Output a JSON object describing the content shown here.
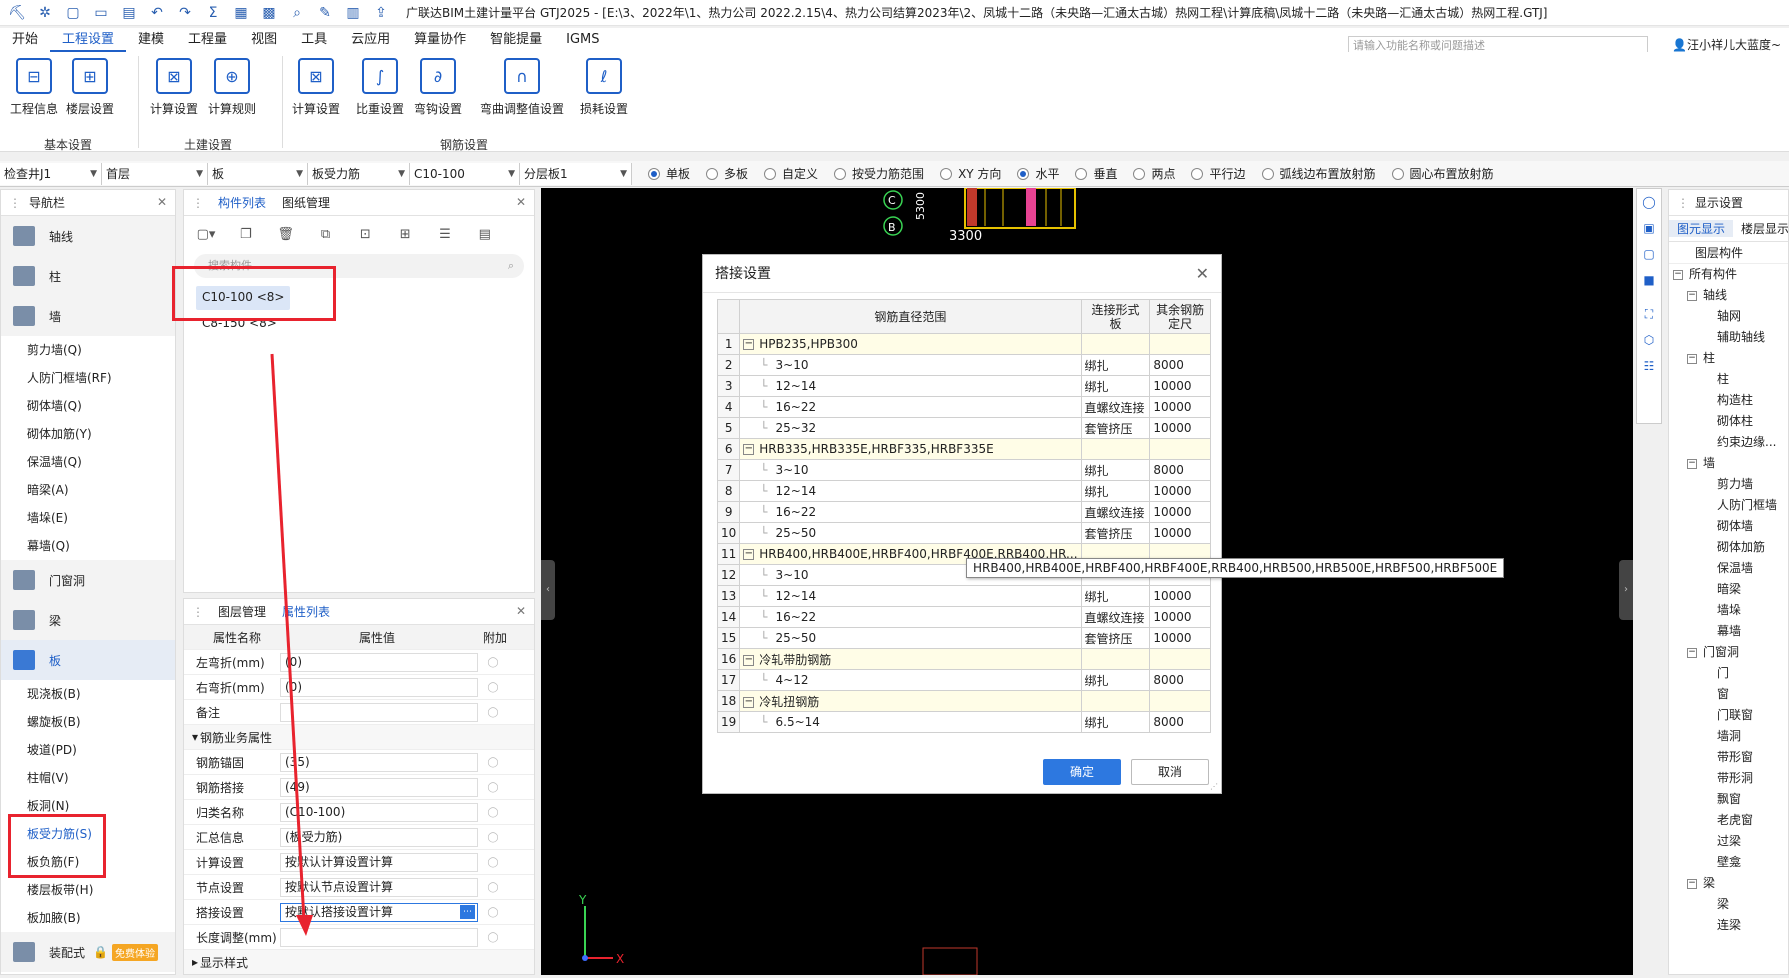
{
  "window": {
    "title": "广联达BIM土建计量平台 GTJ2025 - [E:\\3、2022年\\1、热力公司 2022.2.15\\4、热力公司结算2023年\\2、凤城十二路（未央路—汇通太古城）热网工程\\计算底稿\\凤城十二路（未央路—汇通太古城）热网工程.GTJ]"
  },
  "menu": {
    "tabs": [
      "开始",
      "工程设置",
      "建模",
      "工程量",
      "视图",
      "工具",
      "云应用",
      "算量协作",
      "智能提量",
      "IGMS"
    ],
    "search_placeholder": "请输入功能名称或问题描述",
    "user": "汪小祥儿大蓝度~"
  },
  "ribbon": {
    "groups": [
      {
        "label": "基本设置",
        "buttons": [
          "工程信息",
          "楼层设置"
        ]
      },
      {
        "label": "土建设置",
        "buttons": [
          "计算设置",
          "计算规则"
        ]
      },
      {
        "label": "钢筋设置",
        "buttons": [
          "计算设置",
          "比重设置",
          "弯钩设置",
          "弯曲调整值设置",
          "损耗设置"
        ]
      }
    ]
  },
  "options": {
    "combos": [
      "检查井J1",
      "首层",
      "板",
      "板受力筋",
      "C10-100",
      "分层板1"
    ],
    "radios": [
      {
        "label": "单板",
        "on": true
      },
      {
        "label": "多板",
        "on": false
      },
      {
        "label": "自定义",
        "on": false
      },
      {
        "label": "按受力筋范围",
        "on": false
      },
      {
        "label": "XY 方向",
        "on": false
      },
      {
        "label": "水平",
        "on": true
      },
      {
        "label": "垂直",
        "on": false
      },
      {
        "label": "两点",
        "on": false
      },
      {
        "label": "平行边",
        "on": false
      },
      {
        "label": "弧线边布置放射筋",
        "on": false
      },
      {
        "label": "圆心布置放射筋",
        "on": false
      }
    ]
  },
  "nav": {
    "title": "导航栏",
    "items": [
      {
        "label": "轴线",
        "kind": "big"
      },
      {
        "label": "柱",
        "kind": "big"
      },
      {
        "label": "墙",
        "kind": "big"
      },
      {
        "label": "剪力墙(Q)",
        "kind": "sub"
      },
      {
        "label": "人防门框墙(RF)",
        "kind": "sub"
      },
      {
        "label": "砌体墙(Q)",
        "kind": "sub"
      },
      {
        "label": "砌体加筋(Y)",
        "kind": "sub"
      },
      {
        "label": "保温墙(Q)",
        "kind": "sub"
      },
      {
        "label": "暗梁(A)",
        "kind": "sub"
      },
      {
        "label": "墙垛(E)",
        "kind": "sub"
      },
      {
        "label": "幕墙(Q)",
        "kind": "sub"
      },
      {
        "label": "门窗洞",
        "kind": "big"
      },
      {
        "label": "梁",
        "kind": "big"
      },
      {
        "label": "板",
        "kind": "bigsel"
      },
      {
        "label": "现浇板(B)",
        "kind": "sub"
      },
      {
        "label": "螺旋板(B)",
        "kind": "sub"
      },
      {
        "label": "坡道(PD)",
        "kind": "sub"
      },
      {
        "label": "柱帽(V)",
        "kind": "sub"
      },
      {
        "label": "板洞(N)",
        "kind": "sub"
      },
      {
        "label": "板受力筋(S)",
        "kind": "subsel"
      },
      {
        "label": "板负筋(F)",
        "kind": "sub"
      },
      {
        "label": "楼层板带(H)",
        "kind": "sub"
      },
      {
        "label": "板加腋(B)",
        "kind": "sub"
      }
    ],
    "bottom_label": "装配式",
    "trial_badge": "免费体验"
  },
  "components": {
    "tabs": [
      "构件列表",
      "图纸管理"
    ],
    "search_placeholder": "搜索构件...",
    "items": [
      "C10-100 <8>",
      "C8-150 <8>"
    ]
  },
  "properties": {
    "tabs": [
      "图层管理",
      "属性列表"
    ],
    "headers": [
      "属性名称",
      "属性值",
      "附加"
    ],
    "rows": [
      {
        "name": "左弯折(mm)",
        "value": "(0)"
      },
      {
        "name": "右弯折(mm)",
        "value": "(0)"
      },
      {
        "name": "备注",
        "value": ""
      }
    ],
    "group_title": "钢筋业务属性",
    "group_rows": [
      {
        "name": "钢筋锚固",
        "value": "(35)"
      },
      {
        "name": "钢筋搭接",
        "value": "(49)"
      },
      {
        "name": "归类名称",
        "value": "(C10-100)"
      },
      {
        "name": "汇总信息",
        "value": "(板受力筋)"
      },
      {
        "name": "计算设置",
        "value": "按默认计算设置计算"
      },
      {
        "name": "节点设置",
        "value": "按默认节点设置计算"
      },
      {
        "name": "搭接设置",
        "value": "按默认搭接设置计算"
      },
      {
        "name": "长度调整(mm)",
        "value": ""
      }
    ],
    "footer_group": "显示样式"
  },
  "dialog": {
    "title": "搭接设置",
    "headers": [
      "钢筋直径范围",
      "连接形式",
      "板",
      "其余钢筋定尺"
    ],
    "rows": [
      {
        "n": "1",
        "range": "HPB235,HPB300",
        "conn": "",
        "len": "",
        "group": true
      },
      {
        "n": "2",
        "range": "3~10",
        "conn": "绑扎",
        "len": "8000",
        "group": false
      },
      {
        "n": "3",
        "range": "12~14",
        "conn": "绑扎",
        "len": "10000",
        "group": false
      },
      {
        "n": "4",
        "range": "16~22",
        "conn": "直螺纹连接",
        "len": "10000",
        "group": false
      },
      {
        "n": "5",
        "range": "25~32",
        "conn": "套管挤压",
        "len": "10000",
        "group": false
      },
      {
        "n": "6",
        "range": "HRB335,HRB335E,HRBF335,HRBF335E",
        "conn": "",
        "len": "",
        "group": true
      },
      {
        "n": "7",
        "range": "3~10",
        "conn": "绑扎",
        "len": "8000",
        "group": false
      },
      {
        "n": "8",
        "range": "12~14",
        "conn": "绑扎",
        "len": "10000",
        "group": false
      },
      {
        "n": "9",
        "range": "16~22",
        "conn": "直螺纹连接",
        "len": "10000",
        "group": false
      },
      {
        "n": "10",
        "range": "25~50",
        "conn": "套管挤压",
        "len": "10000",
        "group": false
      },
      {
        "n": "11",
        "range": "HRB400,HRB400E,HRBF400,HRBF400E,RRB400,HR...",
        "conn": "",
        "len": "",
        "group": true
      },
      {
        "n": "12",
        "range": "3~10",
        "conn": "",
        "len": "",
        "group": false
      },
      {
        "n": "13",
        "range": "12~14",
        "conn": "绑扎",
        "len": "10000",
        "group": false
      },
      {
        "n": "14",
        "range": "16~22",
        "conn": "直螺纹连接",
        "len": "10000",
        "group": false
      },
      {
        "n": "15",
        "range": "25~50",
        "conn": "套管挤压",
        "len": "10000",
        "group": false
      },
      {
        "n": "16",
        "range": "冷轧带肋钢筋",
        "conn": "",
        "len": "",
        "group": true
      },
      {
        "n": "17",
        "range": "4~12",
        "conn": "绑扎",
        "len": "8000",
        "group": false
      },
      {
        "n": "18",
        "range": "冷轧扭钢筋",
        "conn": "",
        "len": "",
        "group": true
      },
      {
        "n": "19",
        "range": "6.5~14",
        "conn": "绑扎",
        "len": "8000",
        "group": false
      }
    ],
    "tooltip": "HRB400,HRB400E,HRBF400,HRBF400E,RRB400,HRB500,HRB500E,HRBF500,HRBF500E",
    "ok": "确定",
    "cancel": "取消"
  },
  "canvas": {
    "axis_labels": {
      "x": "X",
      "y": "Y"
    },
    "markers": [
      "C",
      "B"
    ],
    "dim_text": "3300",
    "vertical_text": "5300"
  },
  "display_panel": {
    "title": "显示设置",
    "tabs": [
      "图元显示",
      "楼层显示"
    ],
    "header": "图层构件",
    "tree": [
      {
        "label": "所有构件",
        "level": 0,
        "box": "-"
      },
      {
        "label": "轴线",
        "level": 1,
        "box": "-"
      },
      {
        "label": "轴网",
        "level": 2,
        "box": ""
      },
      {
        "label": "辅助轴线",
        "level": 2,
        "box": ""
      },
      {
        "label": "柱",
        "level": 1,
        "box": "-"
      },
      {
        "label": "柱",
        "level": 2,
        "box": ""
      },
      {
        "label": "构造柱",
        "level": 2,
        "box": ""
      },
      {
        "label": "砌体柱",
        "level": 2,
        "box": ""
      },
      {
        "label": "约束边缘...",
        "level": 2,
        "box": ""
      },
      {
        "label": "墙",
        "level": 1,
        "box": "-"
      },
      {
        "label": "剪力墙",
        "level": 2,
        "box": ""
      },
      {
        "label": "人防门框墙",
        "level": 2,
        "box": ""
      },
      {
        "label": "砌体墙",
        "level": 2,
        "box": ""
      },
      {
        "label": "砌体加筋",
        "level": 2,
        "box": ""
      },
      {
        "label": "保温墙",
        "level": 2,
        "box": ""
      },
      {
        "label": "暗梁",
        "level": 2,
        "box": ""
      },
      {
        "label": "墙垛",
        "level": 2,
        "box": ""
      },
      {
        "label": "幕墙",
        "level": 2,
        "box": ""
      },
      {
        "label": "门窗洞",
        "level": 1,
        "box": "-"
      },
      {
        "label": "门",
        "level": 2,
        "box": ""
      },
      {
        "label": "窗",
        "level": 2,
        "box": ""
      },
      {
        "label": "门联窗",
        "level": 2,
        "box": ""
      },
      {
        "label": "墙洞",
        "level": 2,
        "box": ""
      },
      {
        "label": "带形窗",
        "level": 2,
        "box": ""
      },
      {
        "label": "带形洞",
        "level": 2,
        "box": ""
      },
      {
        "label": "飘窗",
        "level": 2,
        "box": ""
      },
      {
        "label": "老虎窗",
        "level": 2,
        "box": ""
      },
      {
        "label": "过梁",
        "level": 2,
        "box": ""
      },
      {
        "label": "壁龛",
        "level": 2,
        "box": ""
      },
      {
        "label": "梁",
        "level": 1,
        "box": "-"
      },
      {
        "label": "梁",
        "level": 2,
        "box": ""
      },
      {
        "label": "连梁",
        "level": 2,
        "box": ""
      }
    ]
  },
  "colors": {
    "accent": "#1f5fc7",
    "annotation": "#e8232e",
    "primary_button": "#2d78e0"
  }
}
